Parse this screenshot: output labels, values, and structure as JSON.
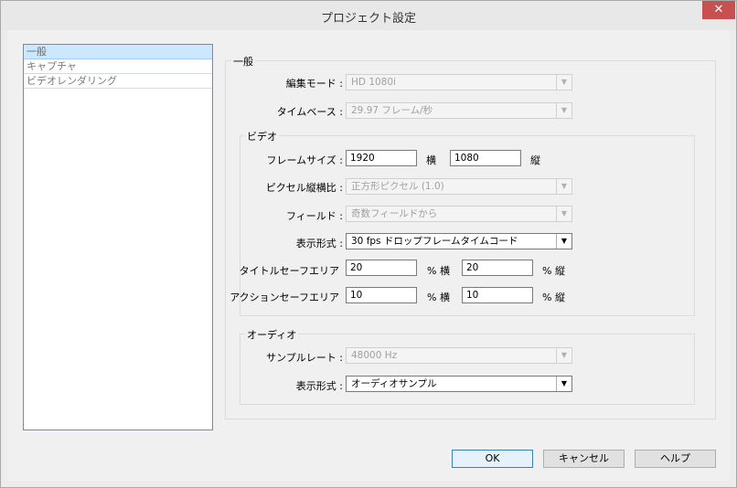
{
  "window": {
    "title": "プロジェクト設定",
    "close_glyph": "✕"
  },
  "sidebar": {
    "items": [
      {
        "label": "一般",
        "selected": true
      },
      {
        "label": "キャプチャ",
        "selected": false
      },
      {
        "label": "ビデオレンダリング",
        "selected": false
      }
    ]
  },
  "general": {
    "group_label": "一般",
    "edit_mode": {
      "label": "編集モード :",
      "value": "HD 1080i"
    },
    "timebase": {
      "label": "タイムベース :",
      "value": "29.97 フレーム/秒"
    }
  },
  "video": {
    "group_label": "ビデオ",
    "frame_size": {
      "label": "フレームサイズ :",
      "width": "1920",
      "width_unit": "横",
      "height": "1080",
      "height_unit": "縦"
    },
    "pixel_aspect": {
      "label": "ピクセル縦横比 :",
      "value": "正方形ピクセル (1.0)"
    },
    "fields": {
      "label": "フィールド :",
      "value": "奇数フィールドから"
    },
    "display_format": {
      "label": "表示形式 :",
      "value": "30 fps ドロップフレームタイムコード"
    },
    "title_safe": {
      "label": "タイトルセーフエリア",
      "h": "20",
      "h_unit": "% 横",
      "v": "20",
      "v_unit": "% 縦"
    },
    "action_safe": {
      "label": "アクションセーフエリア",
      "h": "10",
      "h_unit": "% 横",
      "v": "10",
      "v_unit": "% 縦"
    }
  },
  "audio": {
    "group_label": "オーディオ",
    "sample_rate": {
      "label": "サンプルレート :",
      "value": "48000 Hz"
    },
    "display_format": {
      "label": "表示形式 :",
      "value": "オーディオサンプル"
    }
  },
  "buttons": {
    "ok": "OK",
    "cancel": "キャンセル",
    "help": "ヘルプ"
  },
  "icons": {
    "dropdown_arrow": "▼"
  }
}
